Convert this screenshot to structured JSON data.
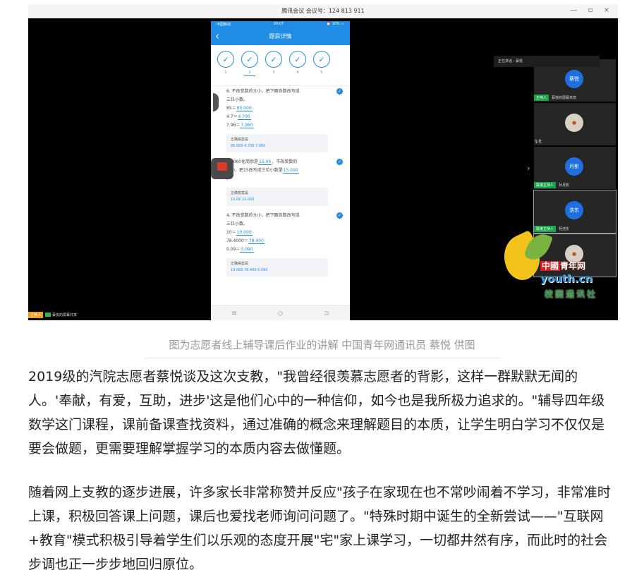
{
  "window": {
    "title": "腾讯会议 会议号：124 813 911",
    "controls": "— ▫ ×"
  },
  "phone": {
    "status_left": "中国移动",
    "status_time": "20:07",
    "status_right": "⏰ 10% ▭",
    "title": "题目详情",
    "steps": [
      "1",
      "2",
      "3",
      "4",
      "5"
    ],
    "questions": [
      {
        "lines": [
          {
            "text": "6.  不改变数的大小，把下面各数改写成"
          },
          {
            "text": "三位小数。"
          },
          {
            "pre": "85＝",
            "ans": "85.000"
          },
          {
            "pre": "4.7＝",
            "ans": "4.700"
          },
          {
            "pre": "7.96＝",
            "ans": "7.960"
          }
        ],
        "answer_label": "正确答案是",
        "answer_value": "85.000  4.700  7.960"
      },
      {
        "lines": [
          {
            "pre": "15.060化简后是",
            "ans": "15.06",
            "post": "，不改变数的"
          },
          {
            "pre": "大小，把15改写成三位小数是",
            "ans": "15.000"
          },
          {
            "text": "。"
          }
        ],
        "answer_label": "正确答案是",
        "answer_value": "15.06  15.000"
      },
      {
        "lines": [
          {
            "text": "4.  不改变数的大小，把下面各数改写成"
          },
          {
            "text": "三位小数。"
          },
          {
            "pre": "10＝",
            "ans": "10.000"
          },
          {
            "pre": "78.4000＝",
            "ans": "78.400"
          },
          {
            "pre": "0.09＝",
            "ans": "0.090"
          }
        ],
        "answer_label": "正确答案是",
        "answer_value": "10.000  78.400  0.090"
      }
    ],
    "nav": [
      "≡",
      "◇",
      "⊃"
    ]
  },
  "meeting": {
    "speaking": "正在讲话：蔡悦",
    "participants": [
      {
        "avatar": "蔡悦",
        "label": "蔡悦的屏幕共享",
        "role": "主持人",
        "photo": false
      },
      {
        "avatar": "",
        "label": "杜",
        "role": "",
        "photo": true
      },
      {
        "avatar": "月影",
        "label": "孙月影",
        "role": "联席主持人",
        "photo": false
      },
      {
        "avatar": "浩东",
        "label": "柯浩东",
        "role": "联席主持人",
        "photo": false
      },
      {
        "avatar": "",
        "label": "",
        "role": "",
        "photo": true
      }
    ],
    "share": {
      "role": "主持人",
      "label": "蔡悦的屏幕共享"
    },
    "expand": "›"
  },
  "watermark": {
    "brand": "中國",
    "brand2": "青年网",
    "url": "youth.cn",
    "school": "校园通讯社"
  },
  "caption": "图为志愿者线上辅导课后作业的讲解 中国青年网通讯员 蔡悦 供图",
  "paragraphs": [
    "2019级的汽院志愿者蔡悦谈及这次支教，\"我曾经很羡慕志愿者的背影，这样一群默默无闻的人。'奉献，有爱，互助，进步'这是他们心中的一种信仰，如今也是我所极力追求的。\"辅导四年级数学这门课程，课前备课查找资料，通过准确的概念来理解题目的本质，让学生明白学习不仅仅是要会做题，更需要理解掌握学习的本质内容去做懂题。",
    "随着网上支教的逐步进展，许多家长非常称赞并反应\"孩子在家现在也不常吵闹着不学习，非常准时上课，积极回答课上问题，课后也爱找老师询问问题了。\"特殊时期中诞生的全新尝试——\"互联网+教育\"模式积极引导着学生们以乐观的态度开展\"宅\"家上课学习，一切都井然有序，而此时的社会步调也正一步步地回归原位。"
  ]
}
